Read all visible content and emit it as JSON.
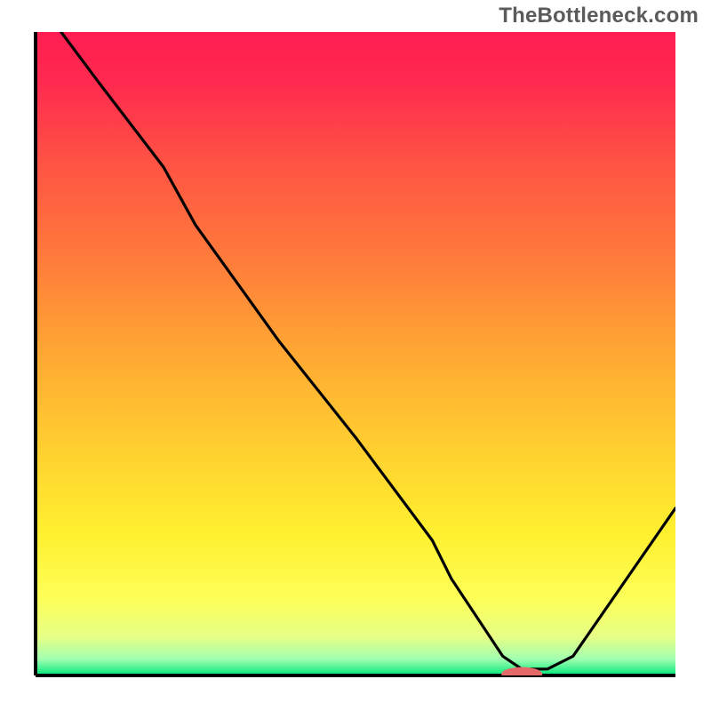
{
  "watermark": "TheBottleneck.com",
  "chart_data": {
    "type": "line",
    "title": "",
    "xlabel": "",
    "ylabel": "",
    "xlim": [
      0,
      100
    ],
    "ylim": [
      0,
      100
    ],
    "grid": false,
    "series": [
      {
        "name": "curve",
        "x": [
          4,
          10,
          20,
          25,
          38,
          50,
          62,
          65,
          73,
          76,
          80,
          84,
          100
        ],
        "y": [
          100,
          92,
          79,
          70,
          52,
          37,
          21,
          15,
          3,
          1,
          1,
          3,
          26
        ]
      }
    ],
    "marker": {
      "cx": 76,
      "cy": 0.2,
      "rx": 3.2,
      "ry": 1.1,
      "color": "#e46a6a"
    },
    "gradient_stops": [
      {
        "offset": 0.0,
        "color": "#ff1e52"
      },
      {
        "offset": 0.08,
        "color": "#ff2a4f"
      },
      {
        "offset": 0.2,
        "color": "#ff5244"
      },
      {
        "offset": 0.35,
        "color": "#ff7a3b"
      },
      {
        "offset": 0.5,
        "color": "#ffa833"
      },
      {
        "offset": 0.65,
        "color": "#ffd02f"
      },
      {
        "offset": 0.78,
        "color": "#fff02f"
      },
      {
        "offset": 0.88,
        "color": "#fdff58"
      },
      {
        "offset": 0.94,
        "color": "#e7ff86"
      },
      {
        "offset": 0.975,
        "color": "#9fffb0"
      },
      {
        "offset": 1.0,
        "color": "#00e87a"
      }
    ],
    "axes": {
      "inner_x": 40,
      "inner_y": 36,
      "inner_w": 720,
      "inner_h": 724,
      "stroke": "#000000",
      "stroke_width": 4
    }
  }
}
